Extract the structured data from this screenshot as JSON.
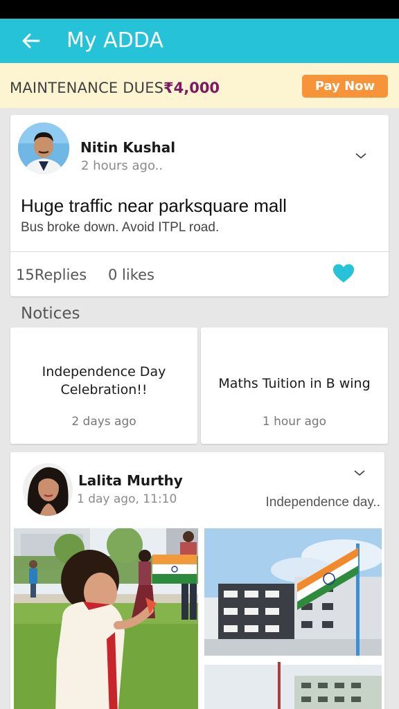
{
  "app": {
    "title": "My ADDA"
  },
  "dues": {
    "label": "MAINTENANCE DUES",
    "amount": "₹4,000",
    "pay_label": "Pay Now"
  },
  "post1": {
    "author": "Nitin Kushal",
    "time": "2 hours ago..",
    "title": "Huge traffic near parksquare mall",
    "subtitle": "Bus broke down. Avoid ITPL road.",
    "replies": "15Replies",
    "likes": "0 likes"
  },
  "notices": {
    "heading": "Notices",
    "items": [
      {
        "title": "Independence Day Celebration!!",
        "time": "2 days ago"
      },
      {
        "title": "Maths Tuition in B wing",
        "time": "1 hour ago"
      }
    ]
  },
  "post2": {
    "author": "Lalita Murthy",
    "time": "1 day ago, 11:10",
    "caption": "Independence day.."
  },
  "colors": {
    "accent": "#26c3d8",
    "dues_bg": "#fdf4d2",
    "amount": "#7b1a5e",
    "pay_button": "#f7943a",
    "heart": "#26c3d8"
  },
  "icons": {
    "back": "arrow-left-icon",
    "menu": "chevron-down-icon",
    "like": "heart-icon"
  }
}
